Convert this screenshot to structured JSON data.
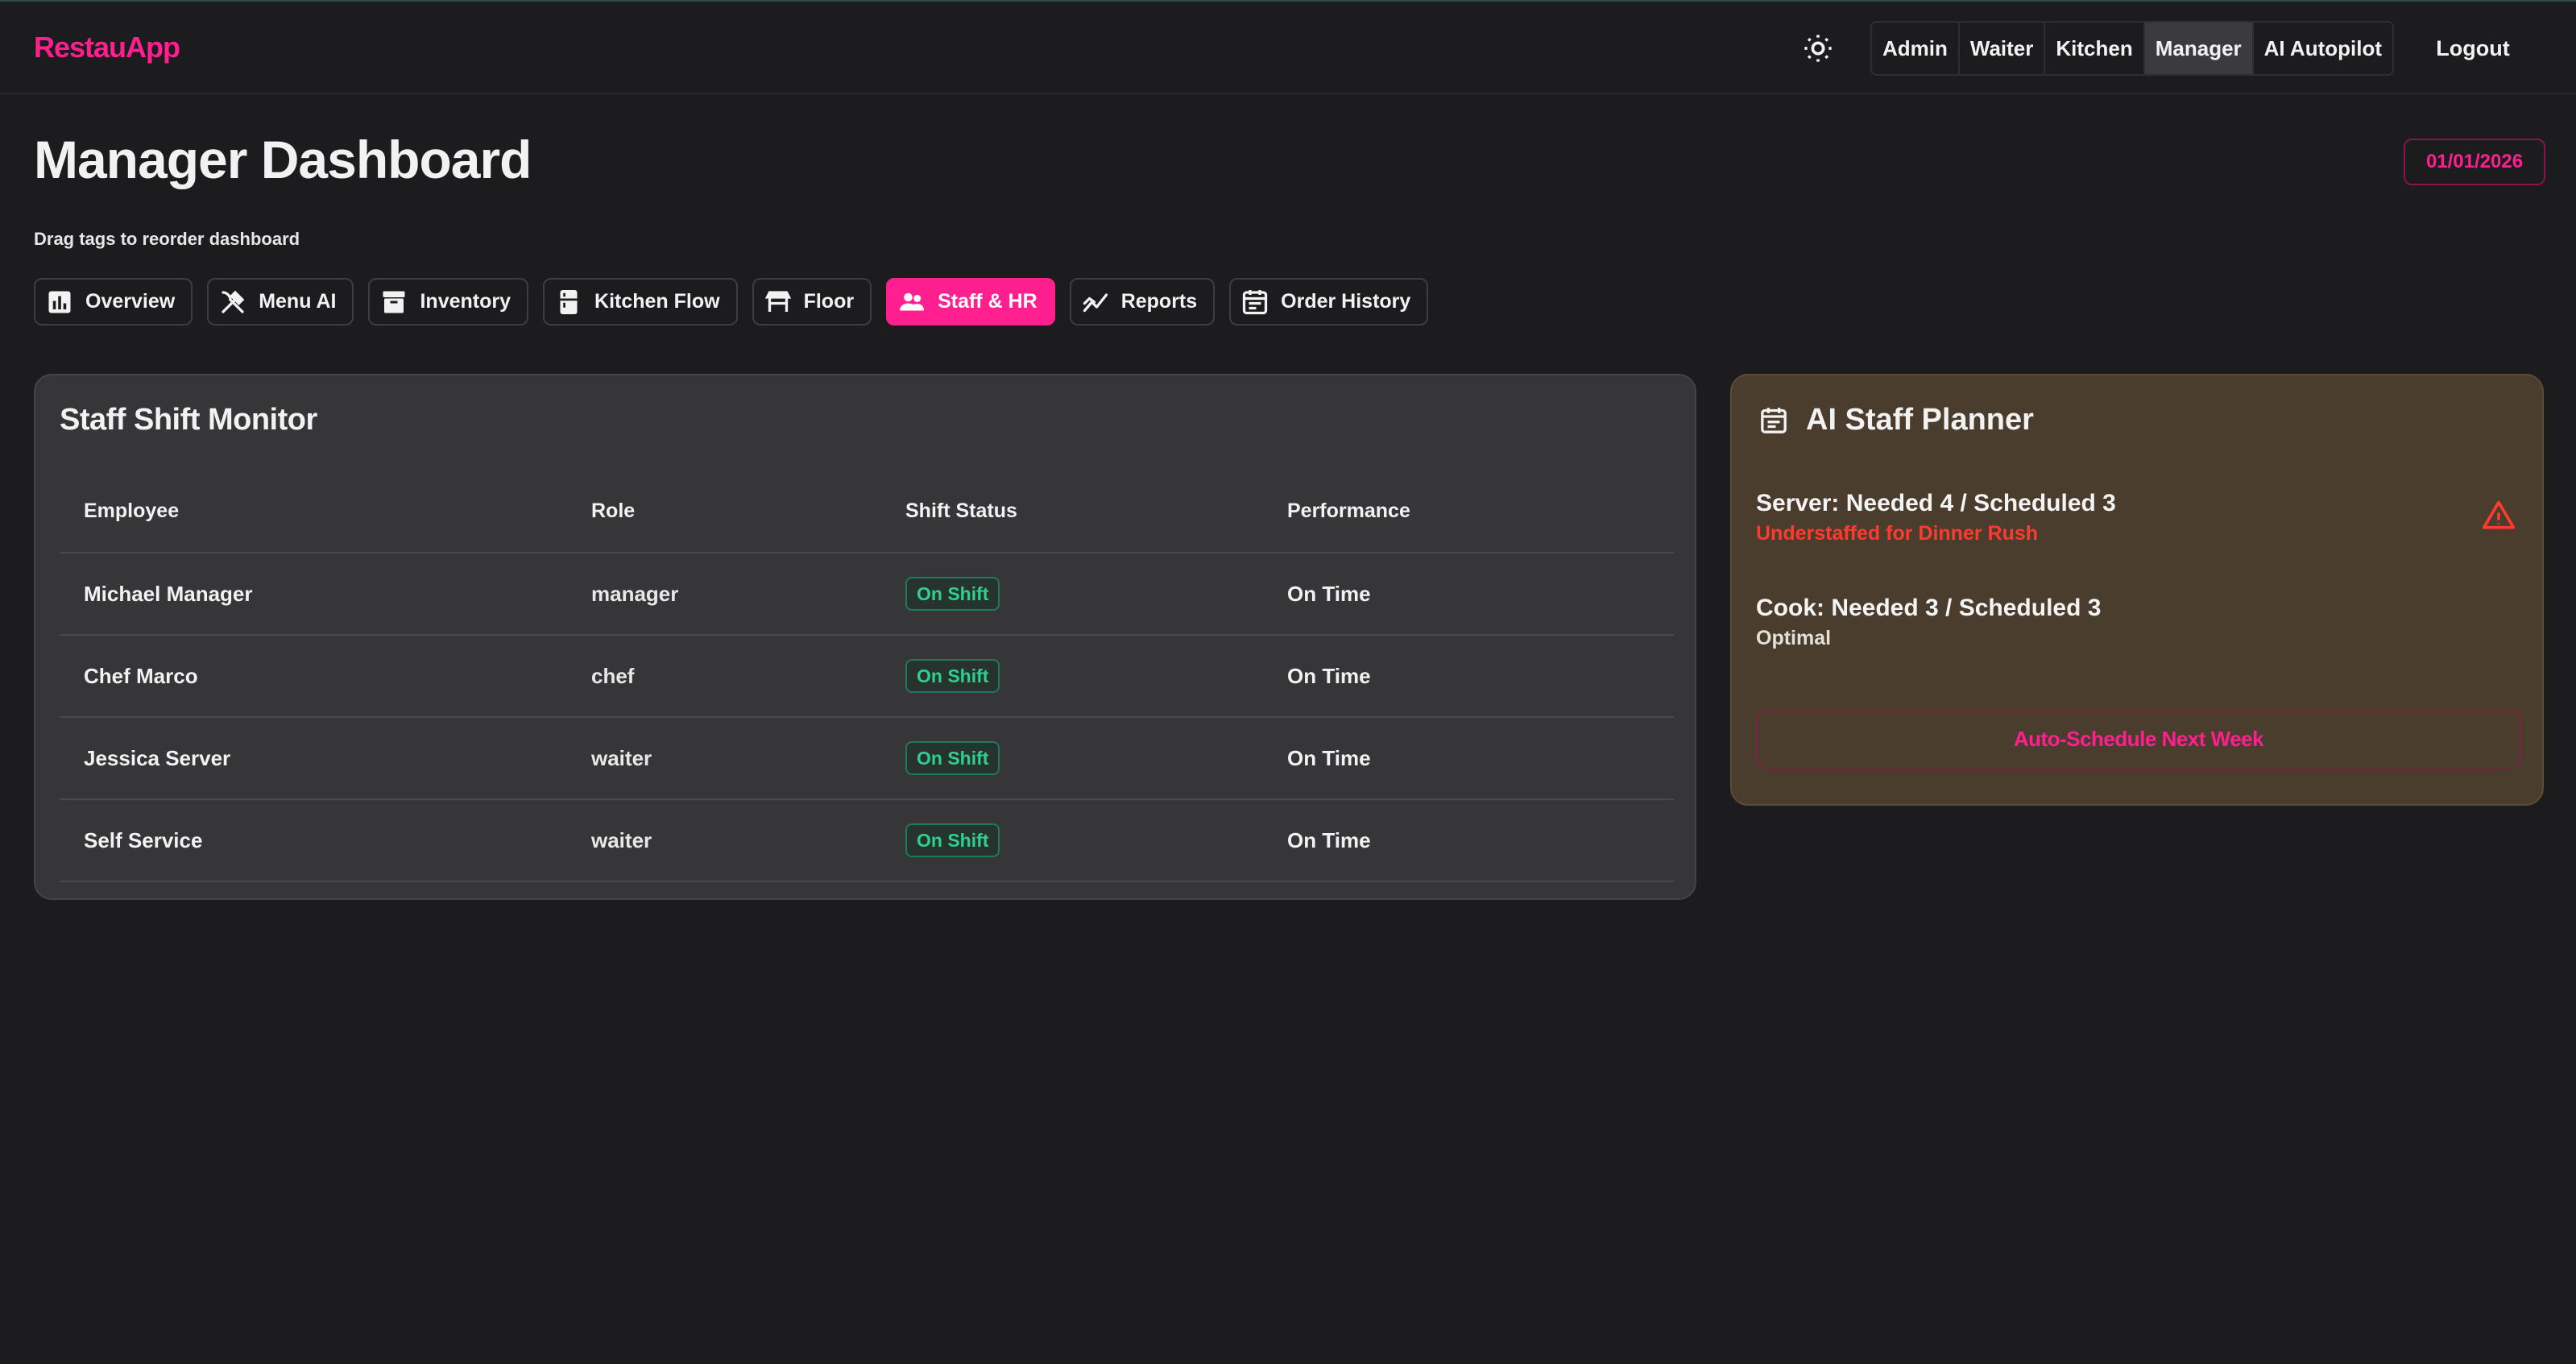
{
  "app": {
    "brand": "RestauApp"
  },
  "nav": {
    "theme_icon": "sun-icon",
    "roles": [
      "Admin",
      "Waiter",
      "Kitchen",
      "Manager",
      "AI Autopilot"
    ],
    "active_role": "Manager",
    "logout_label": "Logout"
  },
  "page": {
    "title": "Manager Dashboard",
    "date": "01/01/2026",
    "drag_hint": "Drag tags to reorder dashboard"
  },
  "tags": [
    {
      "label": "Overview",
      "icon": "bar-chart-icon"
    },
    {
      "label": "Menu AI",
      "icon": "utensils-icon"
    },
    {
      "label": "Inventory",
      "icon": "archive-box-icon"
    },
    {
      "label": "Kitchen Flow",
      "icon": "kitchen-icon"
    },
    {
      "label": "Floor",
      "icon": "table-icon"
    },
    {
      "label": "Staff & HR",
      "icon": "people-icon"
    },
    {
      "label": "Reports",
      "icon": "trend-chart-icon"
    },
    {
      "label": "Order History",
      "icon": "calendar-list-icon"
    }
  ],
  "active_tag": "Staff & HR",
  "shift_monitor": {
    "title": "Staff Shift Monitor",
    "columns": [
      "Employee",
      "Role",
      "Shift Status",
      "Performance"
    ],
    "rows": [
      {
        "employee": "Michael Manager",
        "role": "manager",
        "status": "On Shift",
        "performance": "On Time"
      },
      {
        "employee": "Chef Marco",
        "role": "chef",
        "status": "On Shift",
        "performance": "On Time"
      },
      {
        "employee": "Jessica Server",
        "role": "waiter",
        "status": "On Shift",
        "performance": "On Time"
      },
      {
        "employee": "Self Service",
        "role": "waiter",
        "status": "On Shift",
        "performance": "On Time"
      }
    ]
  },
  "planner": {
    "icon": "calendar-icon",
    "title": "AI Staff Planner",
    "items": [
      {
        "need": "Server: Needed 4 / Scheduled 3",
        "state": "Understaffed for Dinner Rush",
        "level": "warning"
      },
      {
        "need": "Cook: Needed 3 / Scheduled 3",
        "state": "Optimal",
        "level": "ok"
      }
    ],
    "warning_icon": "warning-triangle-icon",
    "action_label": "Auto-Schedule Next Week"
  },
  "colors": {
    "accent": "#ff1f8e",
    "success": "#2fcf8f",
    "danger": "#ff3b30",
    "background": "#1c1c1e",
    "card": "#363638",
    "planner_card": "#4a3d2d"
  }
}
